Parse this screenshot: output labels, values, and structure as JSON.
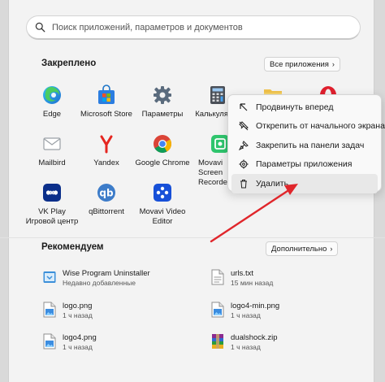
{
  "search": {
    "placeholder": "Поиск приложений, параметров и документов",
    "icon": "search-icon"
  },
  "pinned": {
    "title": "Закреплено",
    "all_apps": "Все приложения",
    "apps": [
      {
        "label": "Edge",
        "icon": "edge-icon"
      },
      {
        "label": "Microsoft Store",
        "icon": "store-icon"
      },
      {
        "label": "Параметры",
        "icon": "gear-icon"
      },
      {
        "label": "Калькулятор",
        "icon": "calculator-icon"
      },
      {
        "label": "",
        "icon": "folder-icon"
      },
      {
        "label": "",
        "icon": "opera-icon"
      },
      {
        "label": "Mailbird",
        "icon": "mail-icon"
      },
      {
        "label": "Yandex",
        "icon": "yandex-icon"
      },
      {
        "label": "Google Chrome",
        "icon": "chrome-icon"
      },
      {
        "label": "Movavi Screen Recorder",
        "label_short": "Movavi Screen Recorde",
        "icon": "movavi-recorder-icon"
      },
      {
        "label": "VK Play Игровой центр",
        "line1": "VK Play",
        "line2": "Игровой центр",
        "icon": "vkplay-icon"
      },
      {
        "label": "qBittorrent",
        "icon": "qbittorrent-icon"
      },
      {
        "label": "Movavi Video Editor",
        "line1": "Movavi Video",
        "line2": "Editor",
        "icon": "movavi-editor-icon"
      }
    ]
  },
  "recommended": {
    "title": "Рекомендуем",
    "more": "Дополнительно",
    "items": [
      {
        "name": "Wise Program Uninstaller",
        "time": "Недавно добавленные",
        "icon": "uninstaller-icon"
      },
      {
        "name": "urls.txt",
        "time": "15 мин назад",
        "icon": "text-file-icon"
      },
      {
        "name": "logo.png",
        "time": "1 ч назад",
        "icon": "image-file-icon"
      },
      {
        "name": "logo4-min.png",
        "time": "1 ч назад",
        "icon": "image-file-icon"
      },
      {
        "name": "logo4.png",
        "time": "1 ч назад",
        "icon": "image-file-icon"
      },
      {
        "name": "dualshock.zip",
        "time": "1 ч назад",
        "icon": "archive-file-icon"
      }
    ]
  },
  "context_menu": {
    "items": [
      {
        "label": "Продвинуть вперед",
        "icon": "arrow-up-left-icon"
      },
      {
        "label": "Открепить от начального экрана",
        "icon": "unpin-icon"
      },
      {
        "label": "Закрепить на панели задач",
        "icon": "pin-icon"
      },
      {
        "label": "Параметры приложения",
        "icon": "gear-icon"
      },
      {
        "label": "Удалить",
        "icon": "trash-icon"
      }
    ]
  },
  "colors": {
    "accent_arrow": "#e0262b",
    "menu_bg": "#f9f9f9",
    "panel_bg": "#f3f3f3"
  }
}
